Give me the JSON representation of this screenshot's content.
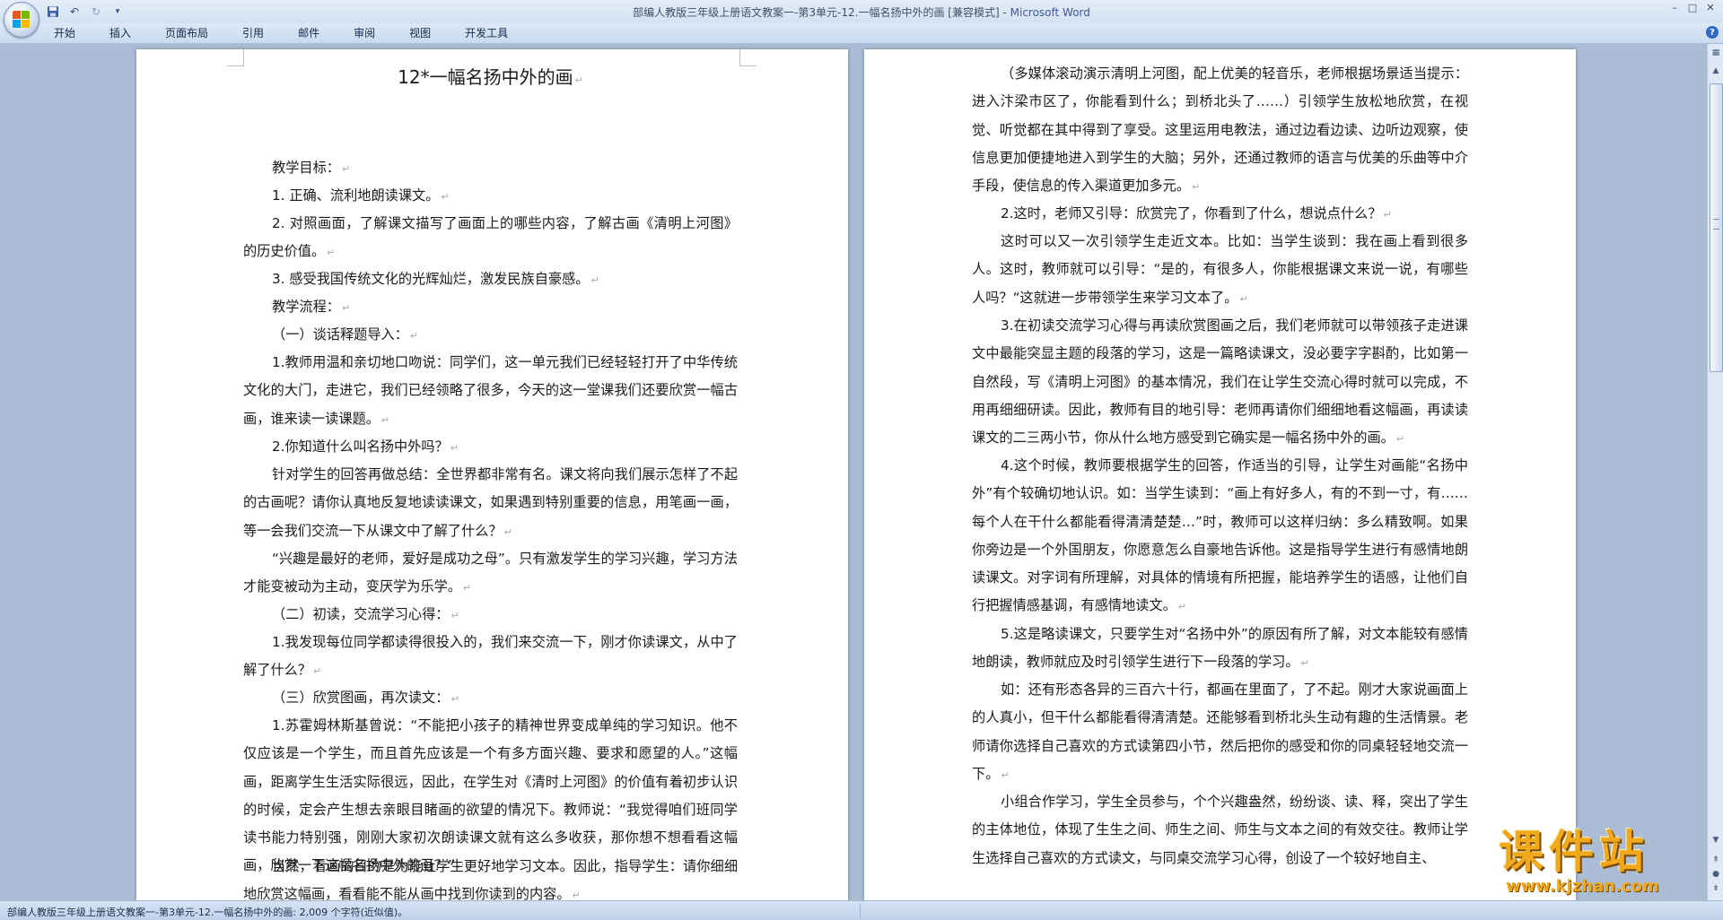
{
  "window": {
    "title": "部编人教版三年级上册语文教案一-第3单元-12.一幅名扬中外的画 [兼容模式] - ",
    "app_name": "Microsoft Word",
    "controls": [
      "–",
      "□",
      "✕"
    ]
  },
  "qat": {
    "undo_label": "↶",
    "redo_label": "↻",
    "customize_label": "▾"
  },
  "ribbon": {
    "tabs": [
      "开始",
      "插入",
      "页面布局",
      "引用",
      "邮件",
      "审阅",
      "视图",
      "开发工具"
    ],
    "help_label": "?"
  },
  "document": {
    "page1": {
      "title": "12*一幅名扬中外的画",
      "paragraphs": [
        "教学目标：",
        "1. 正确、流利地朗读课文。",
        "2. 对照画面，了解课文描写了画面上的哪些内容，了解古画《清明上河图》的历史价值。",
        "3. 感受我国传统文化的光辉灿烂，激发民族自豪感。",
        "教学流程：",
        "（一）谈话释题导入：",
        "1.教师用温和亲切地口吻说：同学们，这一单元我们已经轻轻打开了中华传统文化的大门，走进它，我们已经领略了很多，今天的这一堂课我们还要欣赏一幅古画，谁来读一读课题。",
        "2.你知道什么叫名扬中外吗？",
        "针对学生的回答再做总结：全世界都非常有名。课文将向我们展示怎样了不起的古画呢？请你认真地反复地读读课文，如果遇到特别重要的信息，用笔画一画，等一会我们交流一下从课文中了解了什么？",
        "“兴趣是最好的老师，爱好是成功之母”。只有激发学生的学习兴趣，学习方法才能变被动为主动，变厌学为乐学。",
        "（二）初读，交流学习心得：",
        "1.我发现每位同学都读得很投入的，我们来交流一下，刚才你读课文，从中了解了什么？",
        "（三）欣赏图画，再次读文：",
        "1.苏霍姆林斯基曾说：“不能把小孩子的精神世界变成单纯的学习知识。他不仅应该是一个学生，而且首先应该是一个有多方面兴趣、要求和愿望的人。”这幅画，距离学生生活实际很远，因此，在学生对《清时上河图》的价值有着初步认识的时候，定会产生想去亲眼目睹画的欲望的情况下。教师说：“我觉得咱们班同学读书能力特别强，刚刚大家初次朗读课文就有这么多收获，那你想不想看看这幅画，欣赏一下这幅名扬中外的画？”",
        "当然，看画的目的是为能让学生更好地学习文本。因此，指导学生：请你细细地欣赏这幅画，看看能不能从画中找到你读到的内容。"
      ]
    },
    "page2": {
      "paragraphs": [
        "（多媒体滚动演示清明上河图，配上优美的轻音乐，老师根据场景适当提示：进入汴梁市区了，你能看到什么；到桥北头了……）引领学生放松地欣赏，在视觉、听觉都在其中得到了享受。这里运用电教法，通过边看边读、边听边观察，使信息更加便捷地进入到学生的大脑；另外，还通过教师的语言与优美的乐曲等中介手段，使信息的传入渠道更加多元。",
        "2.这时，老师又引导：欣赏完了，你看到了什么，想说点什么？",
        "这时可以又一次引领学生走近文本。比如：当学生谈到：我在画上看到很多人。这时，教师就可以引导：“是的，有很多人，你能根据课文来说一说，有哪些人吗？“这就进一步带领学生来学习文本了。",
        "3.在初读交流学习心得与再读欣赏图画之后，我们老师就可以带领孩子走进课文中最能突显主题的段落的学习，这是一篇略读课文，没必要字字斟酌，比如第一自然段，写《清明上河图》的基本情况，我们在让学生交流心得时就可以完成，不用再细细研读。因此，教师有目的地引导：老师再请你们细细地看这幅画，再读读课文的二三两小节，你从什么地方感受到它确实是一幅名扬中外的画。",
        "4.这个时候，教师要根据学生的回答，作适当的引导，让学生对画能“名扬中外”有个较确切地认识。如：当学生读到：“画上有好多人，有的不到一寸，有……每个人在干什么都能看得清清楚楚…”时，教师可以这样归纳：多么精致啊。如果你旁边是一个外国朋友，你愿意怎么自豪地告诉他。这是指导学生进行有感情地朗读课文。对字词有所理解，对具体的情境有所把握，能培养学生的语感，让他们自行把握情感基调，有感情地读文。",
        "5.这是略读课文，只要学生对“名扬中外”的原因有所了解，对文本能较有感情地朗读，教师就应及时引领学生进行下一段落的学习。",
        "如：还有形态各异的三百六十行，都画在里面了，了不起。刚才大家说画面上的人真小，但干什么都能看得清清楚。还能够看到桥北头生动有趣的生活情景。老师请你选择自己喜欢的方式读第四小节，然后把你的感受和你的同桌轻轻地交流一下。",
        "小组合作学习，学生全员参与，个个兴趣盎然，纷纷谈、读、释，突出了学生的主体地位，体现了生生之间、师生之间、师生与文本之间的有效交往。教师让学生选择自己喜欢的方式读文，与同桌交流学习心得，创设了一个较好地自主、"
      ]
    },
    "paragraph_mark": "↵"
  },
  "status_bar": {
    "text": "部编人教版三年级上册语文教案一-第3单元-12.一幅名扬中外的画: 2,009 个字符(近似值)。"
  },
  "watermark": {
    "main": "课件站",
    "url": "www.kjzhan.com"
  },
  "colors": {
    "titlebar": "#dbe6f5",
    "workspace": "#abbdd5",
    "watermark": "#f0a81c"
  }
}
